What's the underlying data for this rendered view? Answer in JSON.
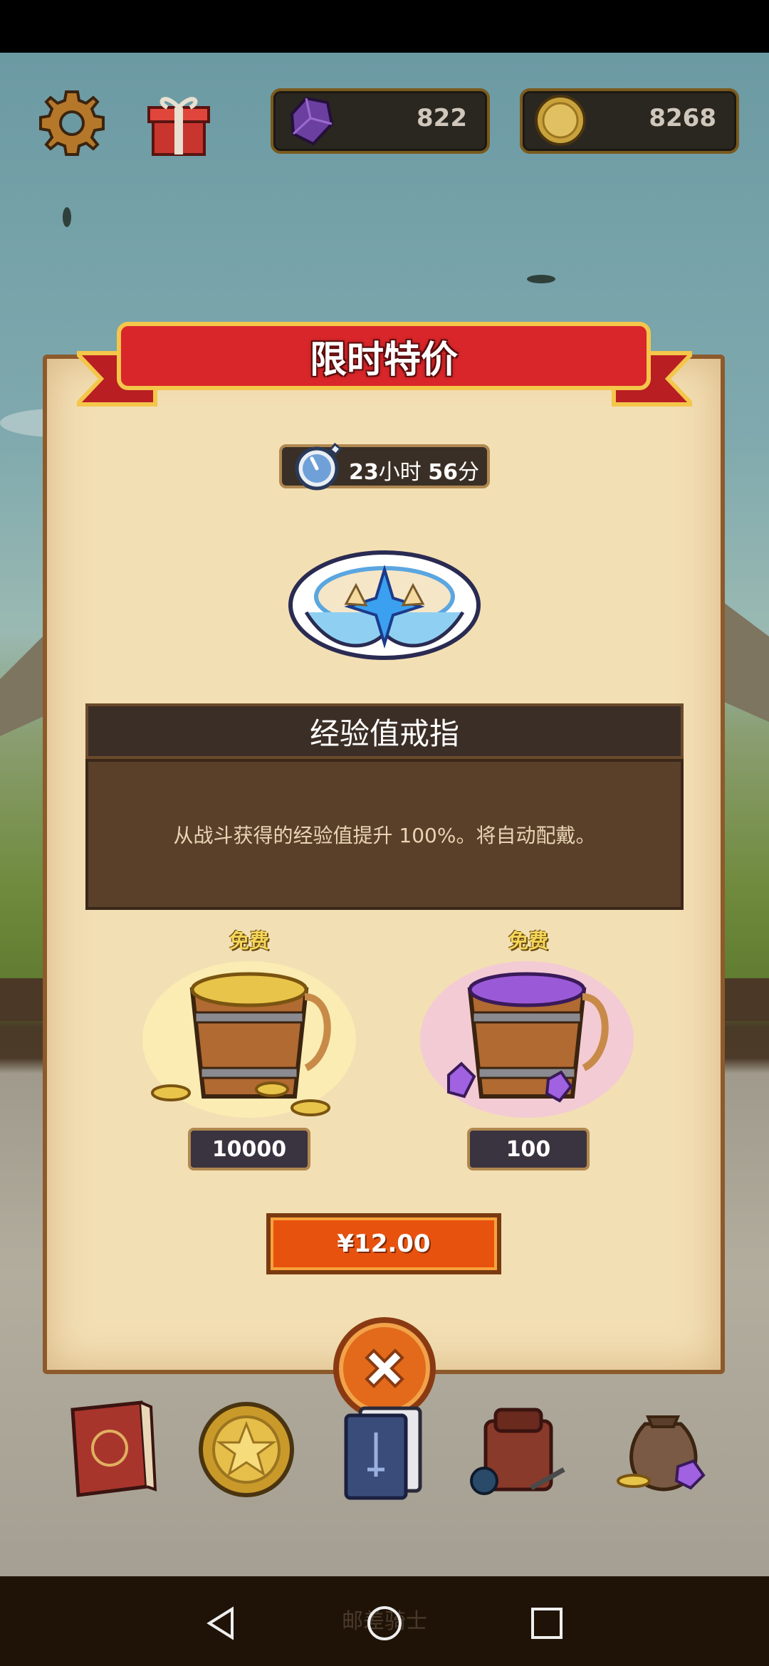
{
  "header": {
    "settings_icon": "gear-icon",
    "gift_icon": "gift-box-icon",
    "gems": {
      "icon": "purple-gem-icon",
      "value": "822"
    },
    "coins": {
      "icon": "gold-coin-icon",
      "value": "8268"
    }
  },
  "offer": {
    "title": "限时特价",
    "timer": {
      "hours": "23",
      "hours_unit": "小时",
      "minutes": "56",
      "minutes_unit": "分"
    },
    "item_icon": "winged-ring-icon",
    "item_name": "经验值戒指",
    "item_description": "从战斗获得的经验值提升 100%。将自动配戴。",
    "rewards": [
      {
        "badge": "免费",
        "icon": "gold-coin-bucket-icon",
        "amount": "10000"
      },
      {
        "badge": "免费",
        "icon": "gem-bucket-icon",
        "amount": "100"
      }
    ],
    "price_label": "¥12.00",
    "close_icon": "close-icon"
  },
  "bottom_menu": {
    "items": [
      "spellbook-icon",
      "star-coin-icon",
      "card-deck-icon",
      "backpack-icon",
      "treasure-bag-icon"
    ]
  },
  "nav": {
    "watermark": "邮差骑士"
  },
  "colors": {
    "ribbon": "#d8262a",
    "panel": "#f3dfb4",
    "buy_button": "#e8520f",
    "close_button": "#e26a1a"
  }
}
